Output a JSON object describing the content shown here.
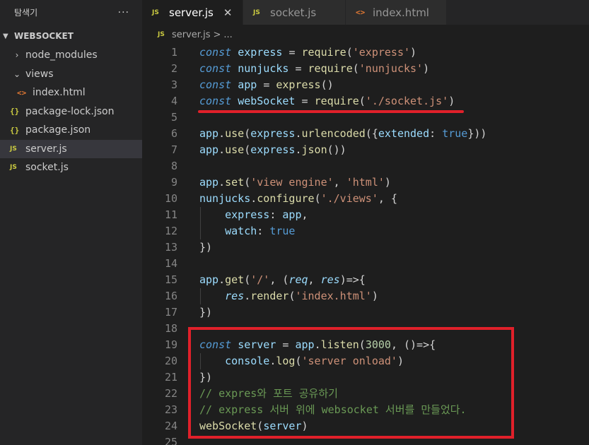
{
  "explorer": {
    "title": "탐색기",
    "more": "···",
    "folder": "WEBSOCKET",
    "items": [
      {
        "label": "node_modules",
        "icon": "chevron-right-icon",
        "kind": "folder"
      },
      {
        "label": "views",
        "icon": "chevron-down-icon",
        "kind": "folder"
      },
      {
        "label": "index.html",
        "icon": "html-file-icon",
        "kind": "file"
      },
      {
        "label": "package-lock.json",
        "icon": "json-file-icon",
        "kind": "file"
      },
      {
        "label": "package.json",
        "icon": "json-file-icon",
        "kind": "file"
      },
      {
        "label": "server.js",
        "icon": "js-file-icon",
        "kind": "file",
        "selected": true
      },
      {
        "label": "socket.js",
        "icon": "js-file-icon",
        "kind": "file"
      }
    ]
  },
  "tabs": [
    {
      "label": "server.js",
      "icon": "JS",
      "active": true
    },
    {
      "label": "socket.js",
      "icon": "JS"
    },
    {
      "label": "index.html",
      "icon": "<>"
    }
  ],
  "tab_close": "✕",
  "breadcrumb": {
    "file": "server.js",
    "sep": ">",
    "rest": "..."
  },
  "icons": {
    "js": "JS",
    "json": "{}",
    "html": "<>",
    "chev_right": "›",
    "chev_down": "⌄"
  },
  "code_lines": [
    "const express = require('express')",
    "const nunjucks = require('nunjucks')",
    "const app = express()",
    "const webSocket = require('./socket.js')",
    "",
    "app.use(express.urlencoded({extended: true}))",
    "app.use(express.json())",
    "",
    "app.set('view engine', 'html')",
    "nunjucks.configure('./views', {",
    "    express: app,",
    "    watch: true",
    "})",
    "",
    "app.get('/', (req, res)=>{",
    "    res.render('index.html')",
    "})",
    "",
    "const server = app.listen(3000, ()=>{",
    "    console.log('server onload')",
    "})",
    "// expres와 포트 공유하기",
    "// express 서버 위에 websocket 서버를 만들었다.",
    "webSocket(server)",
    ""
  ],
  "colors": {
    "annotation": "#e0202a",
    "keyword": "#569cd6",
    "string": "#ce9178",
    "function": "#dcdcaa",
    "variable": "#9cdcfe",
    "comment": "#6a9955",
    "number": "#b5cea8"
  }
}
